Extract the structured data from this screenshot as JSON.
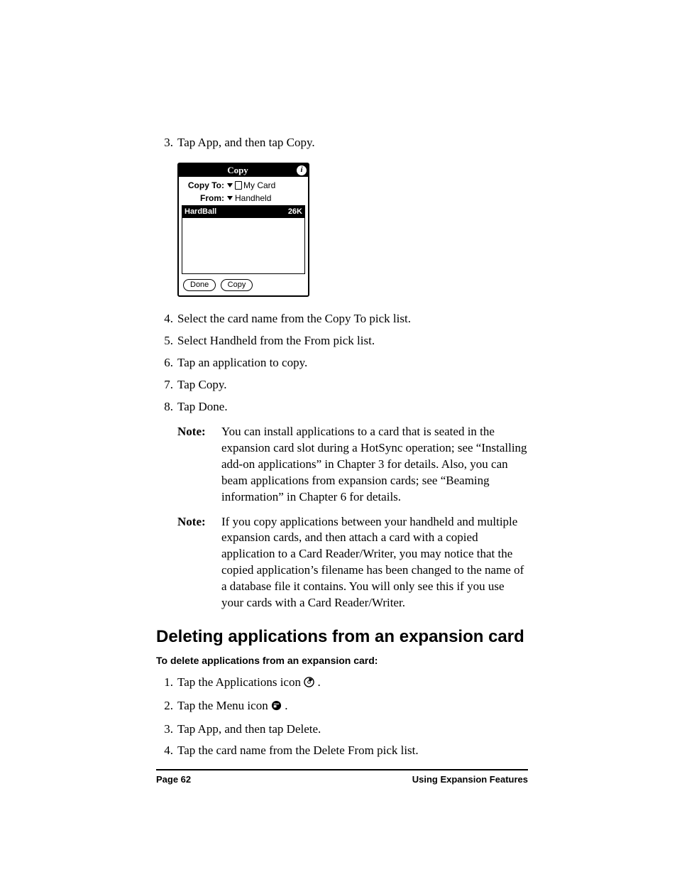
{
  "step3": {
    "num": "3.",
    "text": "Tap App, and then tap Copy."
  },
  "palm": {
    "title": "Copy",
    "info": "i",
    "copyto_label": "Copy To:",
    "copyto_value": "My Card",
    "from_label": "From:",
    "from_value": "Handheld",
    "item_name": "HardBall",
    "item_size": "26K",
    "btn_done": "Done",
    "btn_copy": "Copy"
  },
  "step4": {
    "num": "4.",
    "text": "Select the card name from the Copy To pick list."
  },
  "step5": {
    "num": "5.",
    "text": "Select Handheld from the From pick list."
  },
  "step6": {
    "num": "6.",
    "text": "Tap an application to copy."
  },
  "step7": {
    "num": "7.",
    "text": "Tap Copy."
  },
  "step8": {
    "num": "8.",
    "text": "Tap Done."
  },
  "note1": {
    "label": "Note:",
    "text": "You can install applications to a card that is seated in the expansion card slot during a HotSync operation; see “Installing add-on applications” in Chapter 3 for details. Also, you can beam applications from expansion cards; see “Beaming information” in Chapter 6 for details."
  },
  "note2": {
    "label": "Note:",
    "text": "If you copy applications between your handheld and multiple expansion cards, and then attach a card with a copied application to a Card Reader/Writer, you may notice that the copied application’s filename has been changed to the name of a database file it contains. You will only see this if you use your cards with a Card Reader/Writer."
  },
  "section_heading": "Deleting applications from an expansion card",
  "subhead": "To delete applications from an expansion card:",
  "d_steps": [
    {
      "num": "1.",
      "pre": "Tap the Applications icon ",
      "post": "."
    },
    {
      "num": "2.",
      "pre": "Tap the Menu icon ",
      "post": "."
    },
    {
      "num": "3.",
      "text": "Tap App, and then tap Delete."
    },
    {
      "num": "4.",
      "text": "Tap the card name from the Delete From pick list."
    }
  ],
  "footer": {
    "left": "Page 62",
    "right": "Using Expansion Features"
  }
}
